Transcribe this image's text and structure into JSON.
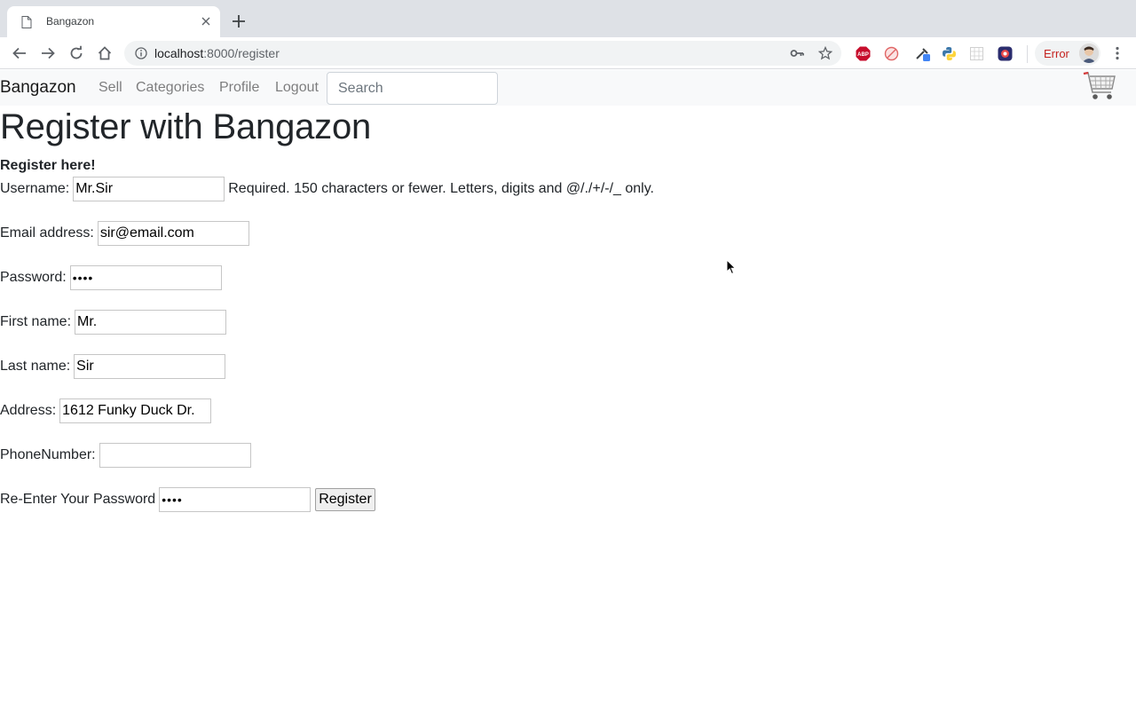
{
  "browser": {
    "tab_title": "Bangazon",
    "url_host": "localhost",
    "url_path": ":8000/register",
    "error_label": "Error",
    "extensions": [
      "adblock-plus-icon",
      "blocker-icon",
      "eyedropper-icon",
      "python-icon",
      "grid-extension-icon",
      "shield-extension-icon"
    ],
    "error_color": "#c5221f"
  },
  "navbar": {
    "brand": "Bangazon",
    "links": [
      "Sell",
      "Categories",
      "Profile",
      "Logout"
    ],
    "search_placeholder": "Search",
    "cart_icon": "shopping-cart-icon"
  },
  "page": {
    "title": "Register with Bangazon",
    "subtitle": "Register here!"
  },
  "form": {
    "username_label": "Username:",
    "username_value": "Mr.Sir",
    "username_help": "Required. 150 characters or fewer. Letters, digits and @/./+/-/_ only.",
    "email_label": "Email address:",
    "email_value": "sir@email.com",
    "password_label": "Password:",
    "password_value": "1234",
    "first_name_label": "First name:",
    "first_name_value": "Mr.",
    "last_name_label": "Last name:",
    "last_name_value": "Sir",
    "address_label": "Address:",
    "address_value": "1612 Funky Duck Dr.",
    "phone_label": "PhoneNumber:",
    "phone_value": "",
    "reenter_label": "Re-Enter Your Password",
    "reenter_value": "1234",
    "submit_label": "Register"
  }
}
